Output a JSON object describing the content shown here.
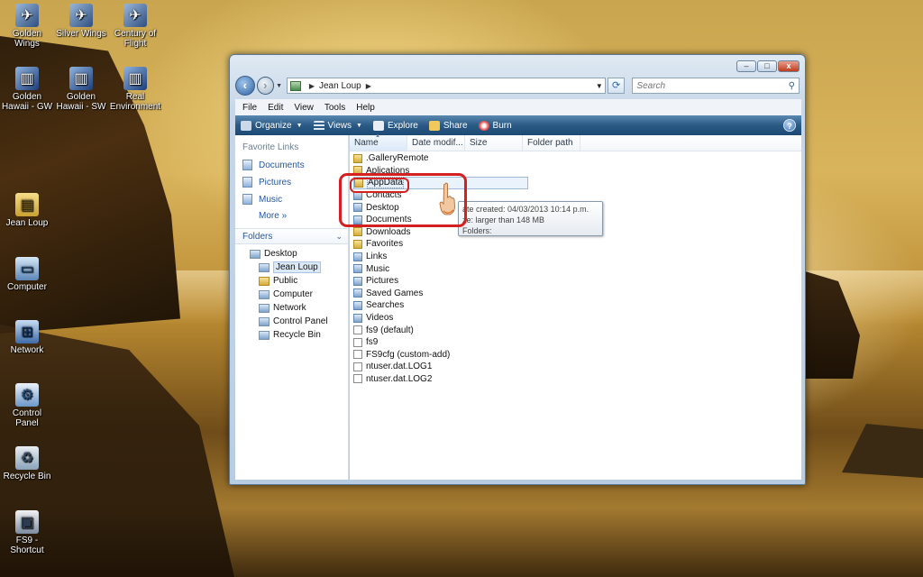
{
  "desktop": {
    "icons": [
      {
        "label": "Golden Wings",
        "icon": "airplane-icon"
      },
      {
        "label": "Silver Wings",
        "icon": "airplane-icon"
      },
      {
        "label": "Century of Flight",
        "icon": "airplane-icon"
      },
      {
        "label": "Golden Hawaii - GW",
        "icon": "city-icon"
      },
      {
        "label": "Golden Hawaii - SW",
        "icon": "city-icon"
      },
      {
        "label": "Real Environment",
        "icon": "city-icon"
      },
      {
        "label": "Jean Loup",
        "icon": "folder-icon"
      },
      {
        "label": "Computer",
        "icon": "computer-icon"
      },
      {
        "label": "Network",
        "icon": "network-icon"
      },
      {
        "label": "Control Panel",
        "icon": "control-panel-icon"
      },
      {
        "label": "Recycle Bin",
        "icon": "recycle-bin-icon"
      },
      {
        "label": "FS9 - Shortcut",
        "icon": "shortcut-icon"
      }
    ]
  },
  "window": {
    "controls": {
      "minimize": "–",
      "maximize": "□",
      "close": "x"
    },
    "address": {
      "crumb": "Jean Loup"
    },
    "search": {
      "placeholder": "Search"
    },
    "menu": [
      "File",
      "Edit",
      "View",
      "Tools",
      "Help"
    ],
    "toolbar": {
      "organize": "Organize",
      "views": "Views",
      "explore": "Explore",
      "share": "Share",
      "burn": "Burn",
      "help": "?"
    },
    "nav": {
      "favorites_header": "Favorite Links",
      "favorites": [
        "Documents",
        "Pictures",
        "Music"
      ],
      "more": "More",
      "folders_header": "Folders",
      "tree": [
        "Desktop",
        "Jean Loup",
        "Public",
        "Computer",
        "Network",
        "Control Panel",
        "Recycle Bin"
      ]
    },
    "columns": [
      "Name",
      "Date modif...",
      "Size",
      "Folder path"
    ],
    "files": [
      {
        "name": ".GalleryRemote",
        "type": "folder"
      },
      {
        "name": "Aplications",
        "type": "folder"
      },
      {
        "name": "AppData",
        "type": "folder"
      },
      {
        "name": "Contacts",
        "type": "library"
      },
      {
        "name": "Desktop",
        "type": "library"
      },
      {
        "name": "Documents",
        "type": "library"
      },
      {
        "name": "Downloads",
        "type": "folder"
      },
      {
        "name": "Favorites",
        "type": "folder"
      },
      {
        "name": "Links",
        "type": "library"
      },
      {
        "name": "Music",
        "type": "library"
      },
      {
        "name": "Pictures",
        "type": "library"
      },
      {
        "name": "Saved Games",
        "type": "library"
      },
      {
        "name": "Searches",
        "type": "library"
      },
      {
        "name": "Videos",
        "type": "library"
      },
      {
        "name": "fs9 (default)",
        "type": "file"
      },
      {
        "name": "fs9",
        "type": "file"
      },
      {
        "name": "FS9cfg (custom-add)",
        "type": "file"
      },
      {
        "name": "ntuser.dat.LOG1",
        "type": "file"
      },
      {
        "name": "ntuser.dat.LOG2",
        "type": "file"
      }
    ],
    "tooltip": {
      "created": "ate created: 04/03/2013 10:14 p.m.",
      "size": "ze: larger than 148 MB",
      "folders": "Folders:"
    }
  },
  "colors": {
    "highlight": "#d42020",
    "toolbar": "#2a5a85",
    "link": "#2457a1"
  }
}
